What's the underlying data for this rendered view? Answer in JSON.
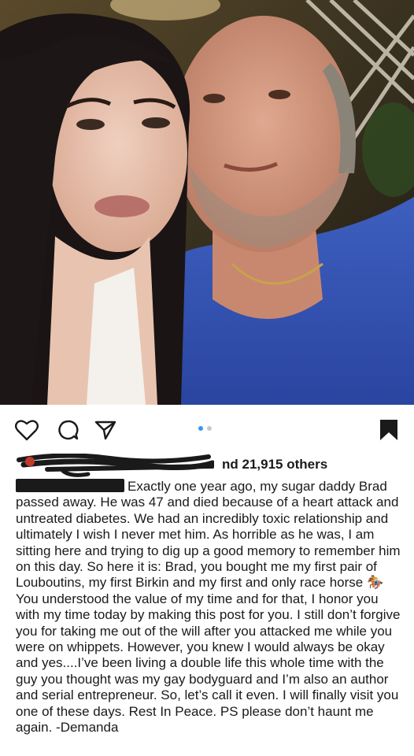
{
  "post": {
    "image": {
      "description_icon": "photo-couple"
    },
    "actions": {
      "like_icon": "heart-outline-icon",
      "comment_icon": "comment-bubble-icon",
      "share_icon": "paper-plane-icon",
      "save_icon": "bookmark-icon"
    },
    "carousel": {
      "count": 2,
      "active_index": 0
    },
    "likes": {
      "prefix": "…",
      "text": "nd 21,915 others"
    },
    "caption": {
      "text": "Exactly one year ago, my sugar daddy Brad passed away. He was 47 and died because of a heart attack and untreated diabetes. We had an incredibly toxic relationship and ultimately I wish I never met him. As horrible as he was, I am sitting here and trying to dig up a good memory to remember him on this day. So here it is: Brad, you bought me my first pair of Louboutins, my first Birkin and my first and only race horse 🏇 You understood the value of my time and for that, I honor you with my time today by making this post for you. I still don’t forgive you for taking me out of the will after you attacked me while you were on whippets. However, you knew I would always be okay and yes....I’ve been living a double life this whole time with the guy you thought was my gay bodyguard and I’m also an author and serial entrepreneur. So, let’s call it even. I will finally visit you one of these days. Rest In Peace. PS please don’t haunt me again. -Demanda"
    },
    "colors": {
      "dot_active": "#3897f0",
      "dot_inactive": "#c8c8c8",
      "text": "#1a1a1a"
    }
  }
}
